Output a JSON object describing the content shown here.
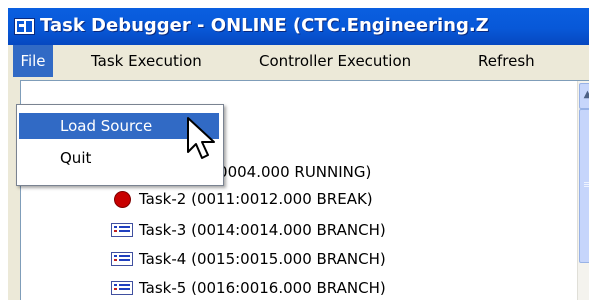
{
  "window": {
    "title": "Task Debugger - ONLINE (CTC.Engineering.Z"
  },
  "menubar": {
    "items": [
      "File",
      "Task Execution",
      "Controller Execution",
      "Refresh"
    ]
  },
  "file_menu": {
    "items": [
      "Load Source",
      "Quit"
    ]
  },
  "tasks": [
    {
      "label": ":0004.000 RUNNING)",
      "icon": "hidden-by-menu"
    },
    {
      "label": "Task-2 (0011:0012.000 BREAK)",
      "icon": "break-icon"
    },
    {
      "label": "Task-3 (0014:0014.000 BRANCH)",
      "icon": "branch-icon"
    },
    {
      "label": "Task-4 (0015:0015.000 BRANCH)",
      "icon": "branch-icon"
    },
    {
      "label": "Task-5 (0016:0016.000 BRANCH)",
      "icon": "branch-icon"
    }
  ],
  "colors": {
    "titlebar": "#0858d8",
    "menu_highlight": "#316ac5",
    "break": "#c80000"
  }
}
